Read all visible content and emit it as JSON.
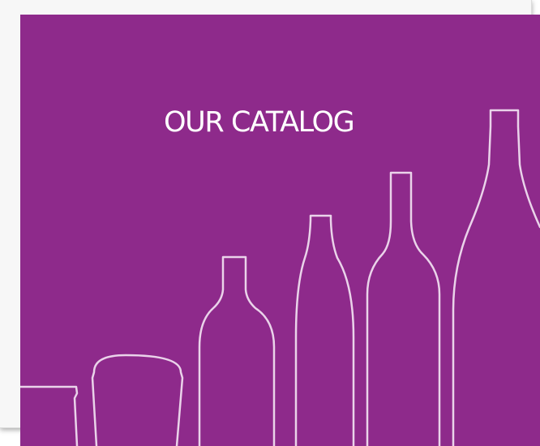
{
  "banner": {
    "title": "OUR CATALOG",
    "background_color": "#8e2a8b",
    "outline_color": "#ead3ea"
  },
  "illustration": {
    "items": [
      "short-tumbler-icon",
      "tall-glass-icon",
      "wide-bottle-icon",
      "slim-bottle-icon",
      "wine-bottle-icon",
      "tall-bottle-icon"
    ]
  }
}
